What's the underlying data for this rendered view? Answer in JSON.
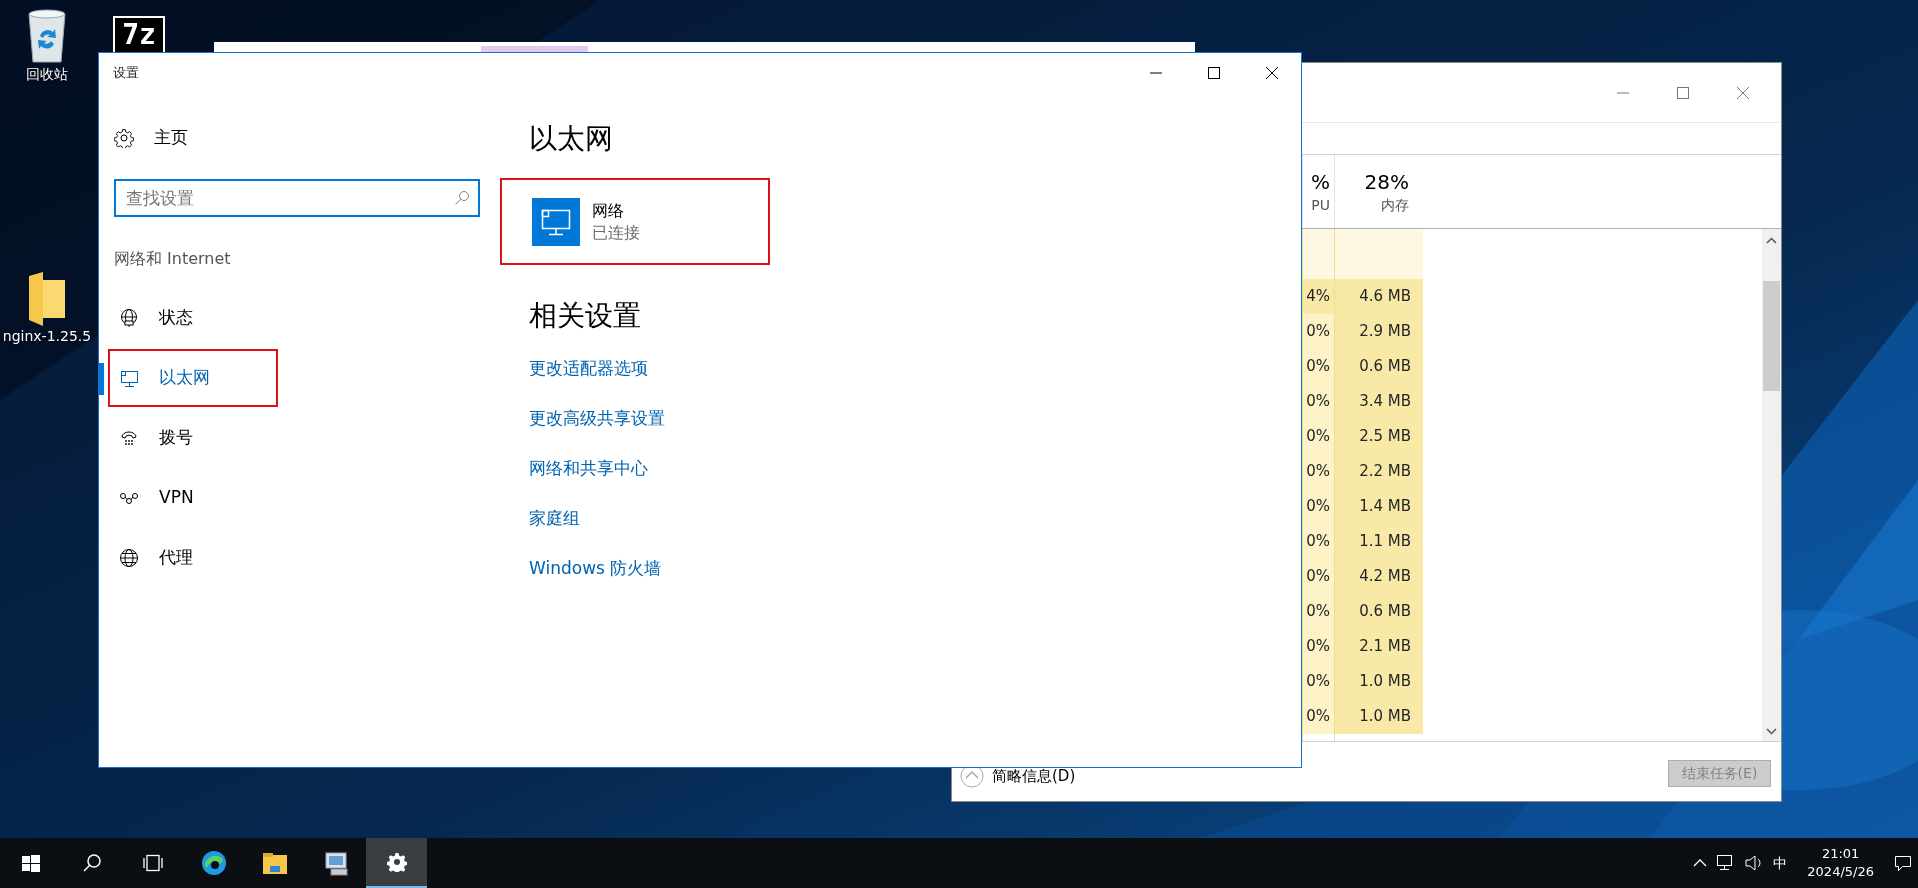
{
  "desktop_icons": [
    {
      "kind": "recycle",
      "label": "回收站"
    },
    {
      "kind": "archive",
      "glyph": "7z"
    },
    {
      "kind": "folder",
      "label": "nginx-1.25.5"
    }
  ],
  "settings_window": {
    "title": "设置",
    "home": "主页",
    "search": {
      "placeholder": "查找设置"
    },
    "section": "网络和 Internet",
    "nav": [
      {
        "kind": "status",
        "label": "状态",
        "selected": false,
        "annotated": false
      },
      {
        "kind": "ethernet",
        "label": "以太网",
        "selected": true,
        "annotated": true
      },
      {
        "kind": "dialup",
        "label": "拨号",
        "selected": false,
        "annotated": false
      },
      {
        "kind": "vpn",
        "label": "VPN",
        "selected": false,
        "annotated": false
      },
      {
        "kind": "proxy",
        "label": "代理",
        "selected": false,
        "annotated": false
      }
    ],
    "heading": "以太网",
    "network": {
      "name": "网络",
      "status": "已连接",
      "annotated": true
    },
    "related_heading": "相关设置",
    "links": [
      "更改适配器选项",
      "更改高级共享设置",
      "网络和共享中心",
      "家庭组",
      "Windows 防火墙"
    ]
  },
  "task_manager": {
    "columns": [
      {
        "total": "%",
        "label": "PU"
      },
      {
        "total": "28%",
        "label": "内存"
      }
    ],
    "rows": [
      [
        "4%",
        "4.6 MB"
      ],
      [
        "0%",
        "2.9 MB"
      ],
      [
        "0%",
        "0.6 MB"
      ],
      [
        "0%",
        "3.4 MB"
      ],
      [
        "0%",
        "2.5 MB"
      ],
      [
        "0%",
        "2.2 MB"
      ],
      [
        "0%",
        "1.4 MB"
      ],
      [
        "0%",
        "1.1 MB"
      ],
      [
        "0%",
        "4.2 MB"
      ],
      [
        "0%",
        "0.6 MB"
      ],
      [
        "0%",
        "2.1 MB"
      ],
      [
        "0%",
        "1.0 MB"
      ],
      [
        "0%",
        "1.0 MB"
      ]
    ],
    "details_toggle": "简略信息(D)",
    "end_task": {
      "label": "结束任务(E)",
      "disabled": true
    }
  },
  "taskbar": {
    "apps": [
      {
        "kind": "start",
        "selected": false
      },
      {
        "kind": "search",
        "selected": false
      },
      {
        "kind": "taskview",
        "selected": false
      },
      {
        "kind": "browser",
        "selected": false
      },
      {
        "kind": "explorer",
        "selected": false
      },
      {
        "kind": "server",
        "selected": false
      },
      {
        "kind": "settings",
        "selected": true
      }
    ],
    "tray": {
      "ime": "中",
      "time": "21:01",
      "date": "2024/5/26"
    }
  }
}
